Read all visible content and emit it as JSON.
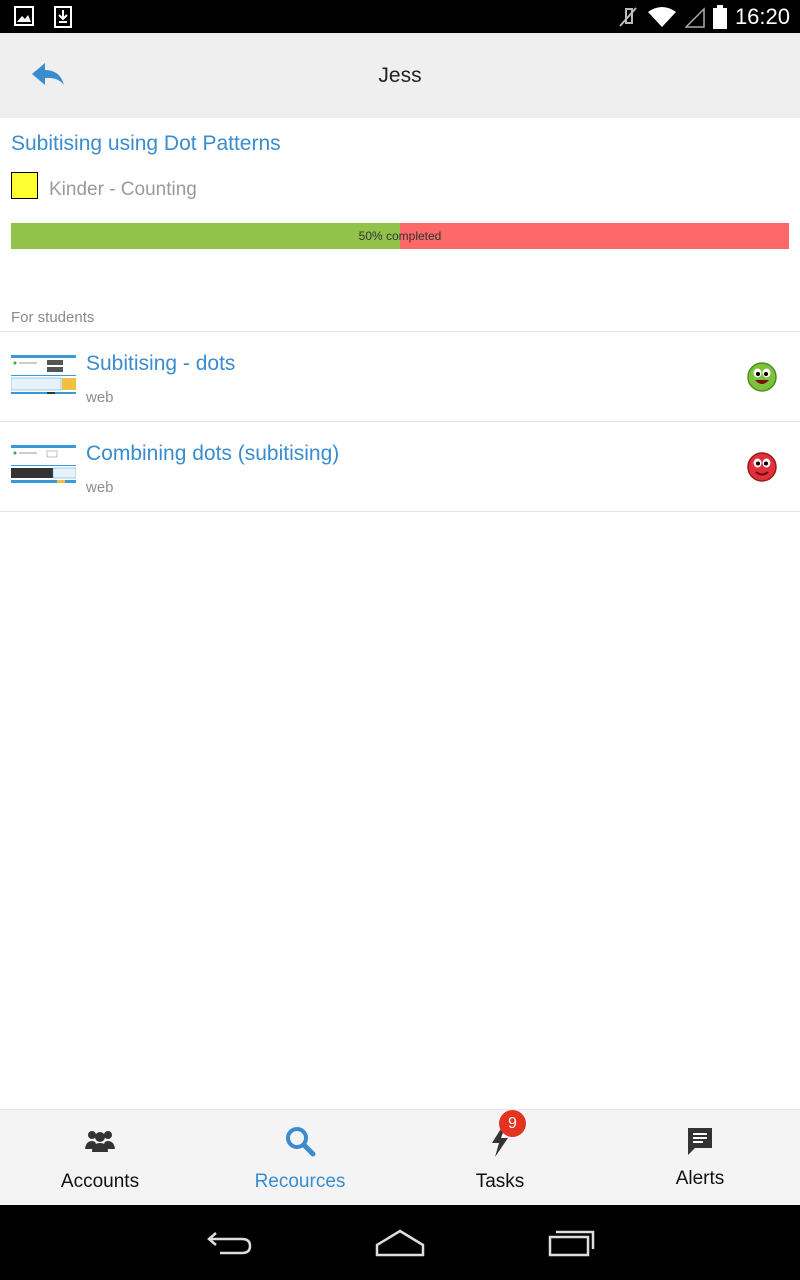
{
  "status_bar": {
    "time": "16:20",
    "icons": [
      "image-icon",
      "download-icon",
      "mute-icon",
      "wifi-icon",
      "signal-icon",
      "battery-icon"
    ]
  },
  "header": {
    "title": "Jess",
    "back_icon": "back-arrow-icon"
  },
  "lesson": {
    "title": "Subitising using Dot Patterns",
    "category": "Kinder - Counting",
    "category_color": "#ffff33",
    "progress_fraction": 0.5,
    "progress_text": "50%  completed",
    "progress_fill_color": "#92c24a",
    "progress_remaining_color": "#fd6868"
  },
  "section": {
    "label": "For students"
  },
  "resources": [
    {
      "title": "Subitising - dots",
      "type": "web",
      "status_icon": "happy-face-icon",
      "status_color": "#7cc23a"
    },
    {
      "title": "Combining dots (subitising)",
      "type": "web",
      "status_icon": "sad-face-icon",
      "status_color": "#e0303a"
    }
  ],
  "bottom_nav": {
    "items": [
      {
        "label": "Accounts",
        "icon": "users-icon"
      },
      {
        "label": "Recources",
        "icon": "search-icon"
      },
      {
        "label": "Tasks",
        "icon": "bolt-icon",
        "badge": "9"
      },
      {
        "label": "Alerts",
        "icon": "message-icon"
      }
    ],
    "active_index": 1,
    "active_color": "#3a8ccf"
  },
  "system_nav": {
    "buttons": [
      "back-icon",
      "home-icon",
      "recents-icon"
    ]
  }
}
